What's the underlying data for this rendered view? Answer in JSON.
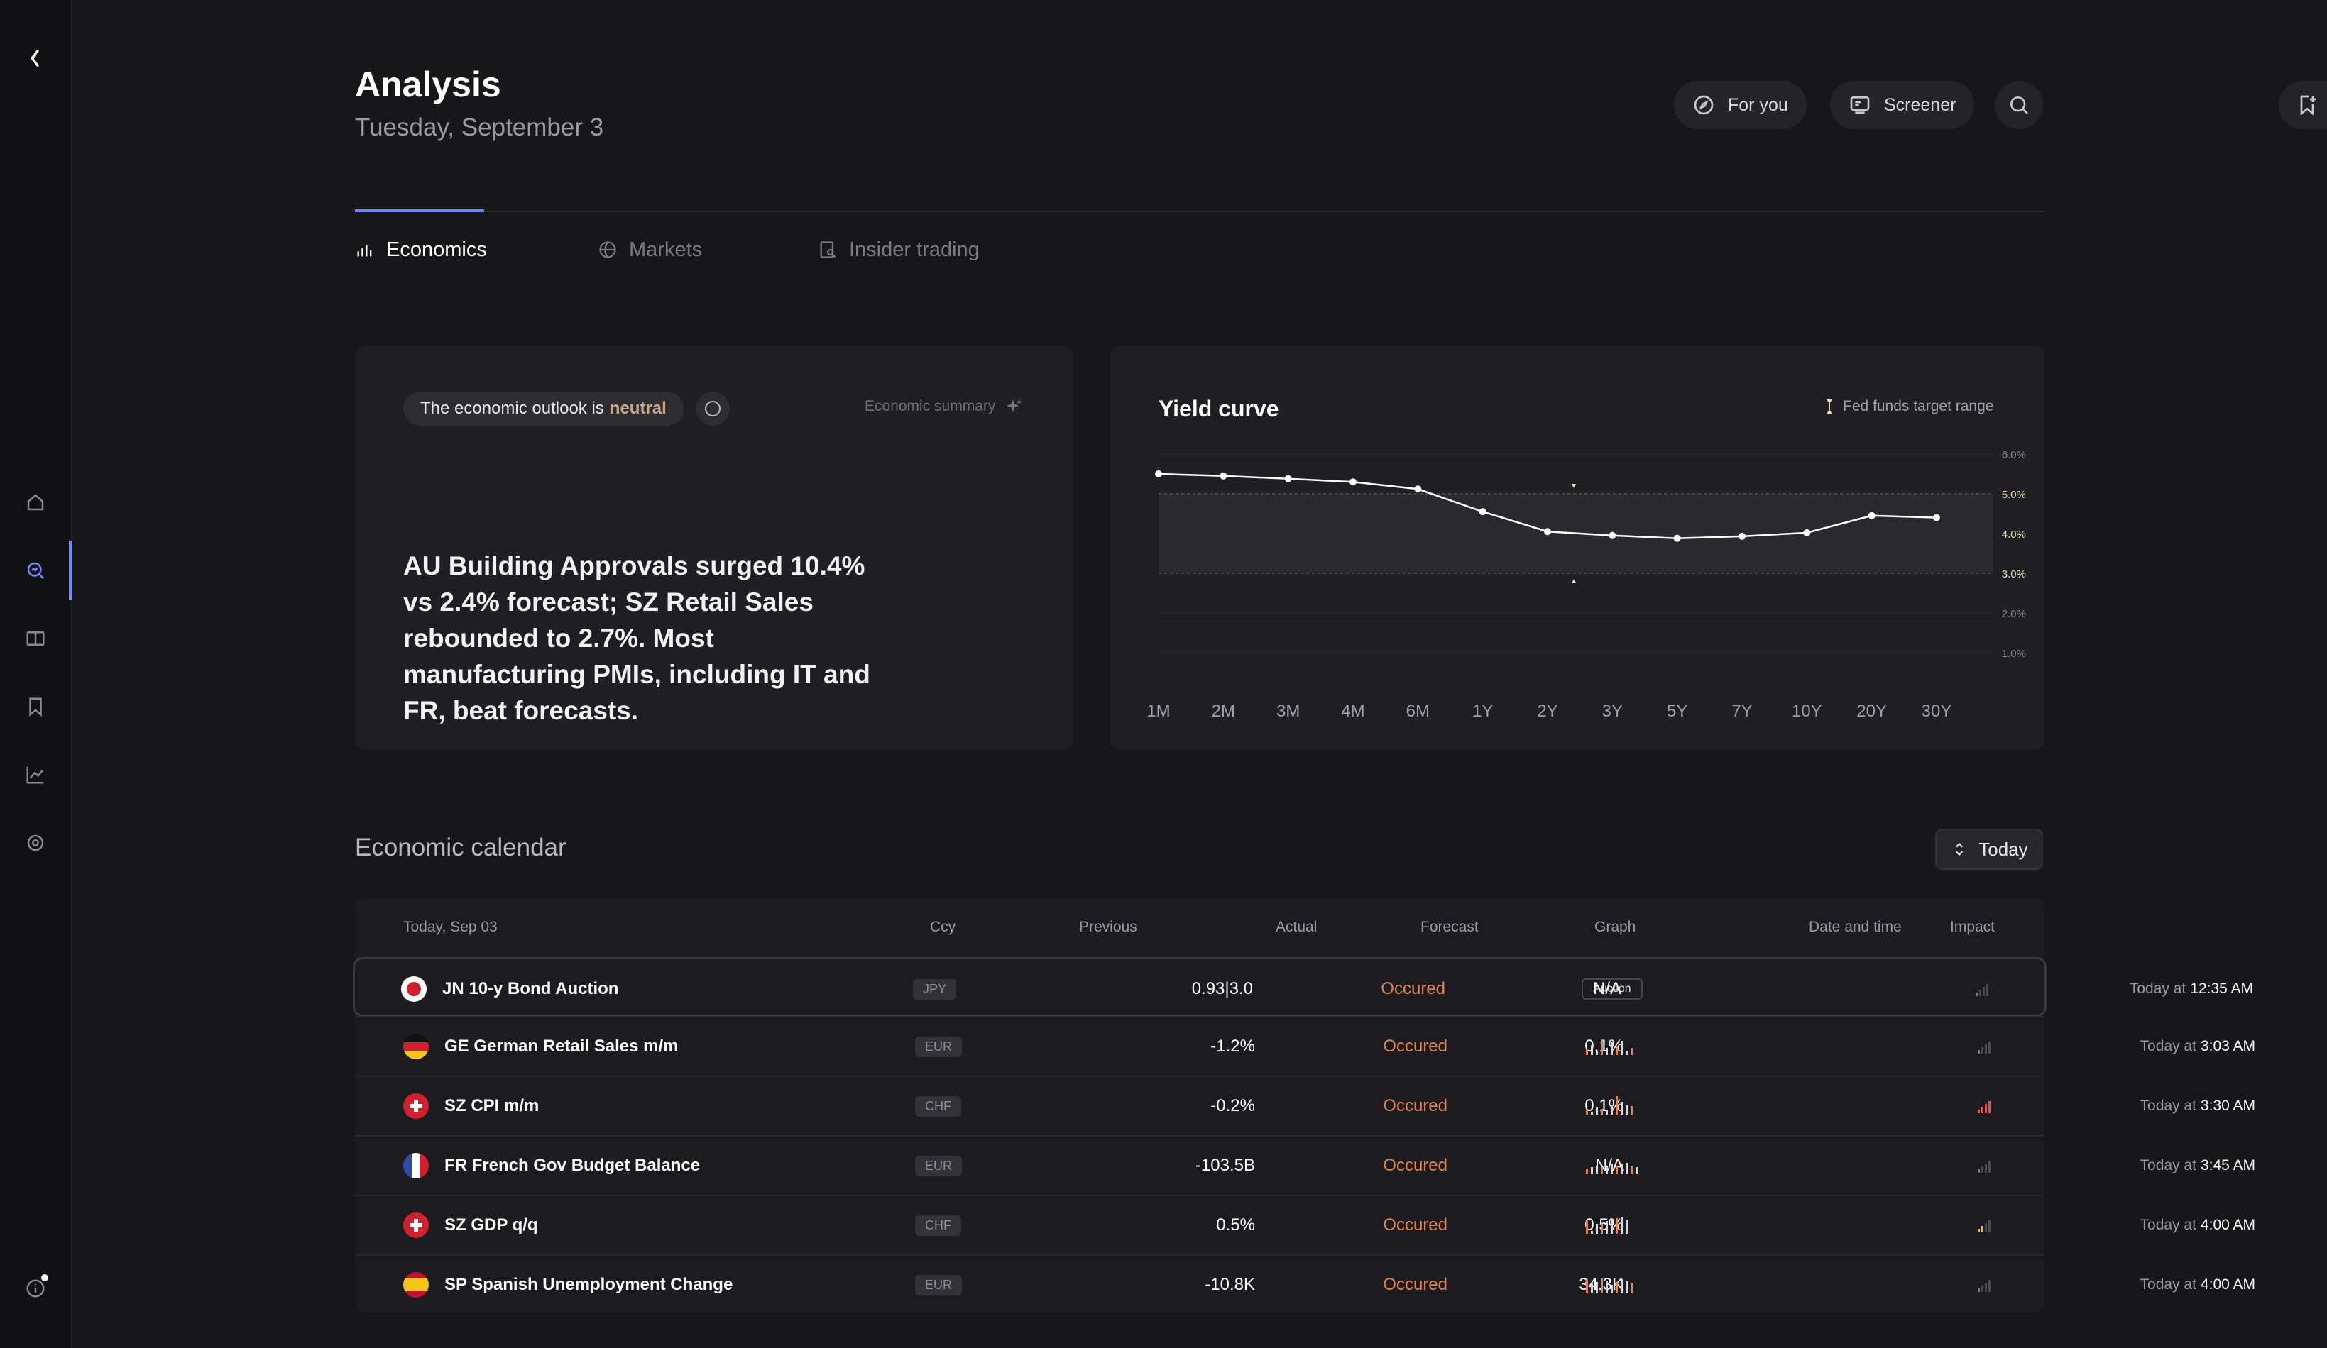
{
  "header": {
    "title": "Analysis",
    "date": "Tuesday, September 3",
    "for_you_label": "For you",
    "screener_label": "Screener"
  },
  "sidebar": {
    "items": [
      "logo-icon",
      "home-icon",
      "analysis-icon",
      "book-icon",
      "bookmark-icon",
      "chart-icon",
      "settings-icon",
      "info-icon"
    ],
    "active": "analysis-icon"
  },
  "tabs": [
    {
      "label": "Economics",
      "icon": "bar-chart-icon",
      "active": true
    },
    {
      "label": "Markets",
      "icon": "globe-icon",
      "active": false
    },
    {
      "label": "Insider trading",
      "icon": "insider-icon",
      "active": false
    }
  ],
  "outlook": {
    "prefix": "The economic outlook is",
    "value": "neutral",
    "summary_link": "Economic summary",
    "headline": "AU Building Approvals surged 10.4% vs 2.4% forecast; SZ Retail Sales rebounded to 2.7%. Most manufacturing PMIs, including IT and FR, beat forecasts."
  },
  "chart_data": {
    "type": "line",
    "title": "Yield curve",
    "categories": [
      "1M",
      "2M",
      "3M",
      "4M",
      "6M",
      "1Y",
      "2Y",
      "3Y",
      "5Y",
      "7Y",
      "10Y",
      "20Y",
      "30Y"
    ],
    "series": [
      {
        "values": [
          5.5,
          5.45,
          5.38,
          5.3,
          5.12,
          4.55,
          4.05,
          3.95,
          3.88,
          3.93,
          4.02,
          4.45,
          4.4
        ]
      }
    ],
    "band": {
      "name": "Fed funds target range",
      "low": 3.0,
      "high": 5.0
    },
    "y_ticks": [
      "6.0%",
      "5.0%",
      "4.0%",
      "3.0%",
      "2.0%",
      "1.0%"
    ],
    "ylim": [
      0.5,
      6.0
    ],
    "colors": {
      "line": "#ffffff",
      "band": "#2a2a2e",
      "band_label": "#e8e0a0"
    }
  },
  "calendar": {
    "title": "Economic calendar",
    "range_label": "Today",
    "columns": {
      "date": "Today, Sep 03",
      "ccy": "Ccy",
      "previous": "Previous",
      "actual": "Actual",
      "forecast": "Forecast",
      "graph": "Graph",
      "datetime": "Date and time",
      "impact": "Impact"
    },
    "rows": [
      {
        "flag": "JN",
        "event": "JN 10-y Bond Auction",
        "ccy": "JPY",
        "previous": "0.93|3.0",
        "actual": "Occured",
        "forecast": "N/A",
        "graph": "Auction",
        "date_prefix": "Today at",
        "time": "12:35 AM",
        "impact": 1
      },
      {
        "flag": "GE",
        "event": "GE German Retail Sales m/m",
        "ccy": "EUR",
        "previous": "-1.2%",
        "actual": "Occured",
        "forecast": "0.1%",
        "graph": "",
        "date_prefix": "Today at",
        "time": "3:03 AM",
        "impact": 1
      },
      {
        "flag": "SZ",
        "event": "SZ CPI m/m",
        "ccy": "CHF",
        "previous": "-0.2%",
        "actual": "Occured",
        "forecast": "0.1%",
        "graph": "",
        "date_prefix": "Today at",
        "time": "3:30 AM",
        "impact": 3
      },
      {
        "flag": "FR",
        "event": "FR French Gov Budget Balance",
        "ccy": "EUR",
        "previous": "-103.5B",
        "actual": "Occured",
        "forecast": "N/A",
        "graph": "",
        "date_prefix": "Today at",
        "time": "3:45 AM",
        "impact": 1
      },
      {
        "flag": "SZ",
        "event": "SZ GDP q/q",
        "ccy": "CHF",
        "previous": "0.5%",
        "actual": "Occured",
        "forecast": "0.5%",
        "graph": "",
        "date_prefix": "Today at",
        "time": "4:00 AM",
        "impact": 2
      },
      {
        "flag": "SP",
        "event": "SP Spanish Unemployment Change",
        "ccy": "EUR",
        "previous": "-10.8K",
        "actual": "Occured",
        "forecast": "34.3K",
        "graph": "",
        "date_prefix": "Today at",
        "time": "4:00 AM",
        "impact": 1
      }
    ]
  }
}
